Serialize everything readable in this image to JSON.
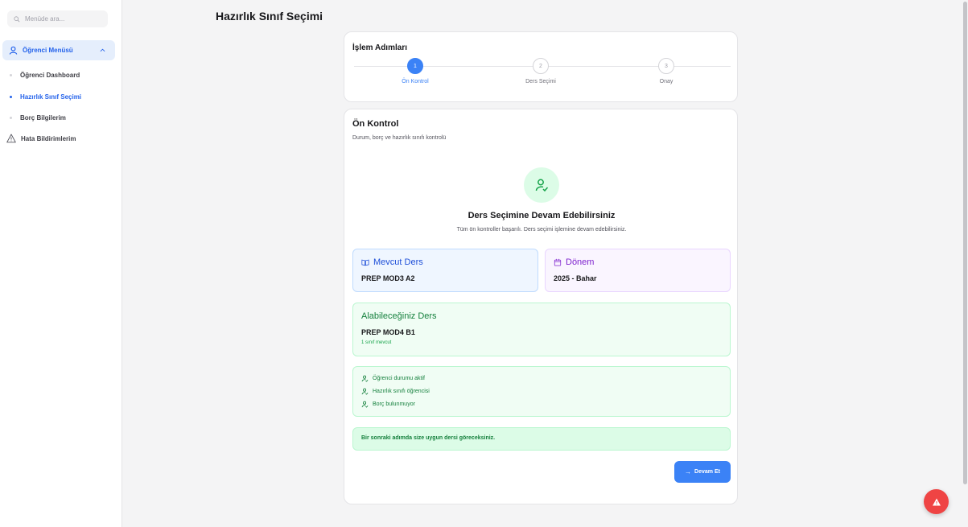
{
  "sidebar": {
    "search_placeholder": "Menüde ara...",
    "group_label": "Öğrenci Menüsü",
    "items": [
      {
        "label": "Öğrenci Dashboard",
        "active": false
      },
      {
        "label": "Hazırlık Sınıf Seçimi",
        "active": true
      },
      {
        "label": "Borç Bilgilerim",
        "active": false
      }
    ],
    "error_item": "Hata Bildirimlerim"
  },
  "page": {
    "title": "Hazırlık Sınıf Seçimi"
  },
  "steps": {
    "title": "İşlem Adımları",
    "items": [
      {
        "number": "1",
        "label": "Ön Kontrol",
        "active": true
      },
      {
        "number": "2",
        "label": "Ders Seçimi",
        "active": false
      },
      {
        "number": "3",
        "label": "Onay",
        "active": false
      }
    ]
  },
  "precheck": {
    "title": "Ön Kontrol",
    "subtitle": "Durum, borç ve hazırlık sınıfı kontrolü",
    "success_title": "Ders Seçimine Devam Edebilirsiniz",
    "success_sub": "Tüm ön kontroller başarılı. Ders seçimi işlemine devam edebilirsiniz.",
    "current_course": {
      "label": "Mevcut Ders",
      "value": "PREP MOD3 A2"
    },
    "term": {
      "label": "Dönem",
      "value": "2025 - Bahar"
    },
    "available": {
      "label": "Alabileceğiniz Ders",
      "value": "PREP MOD4 B1",
      "note": "1 sınıf mevcut"
    },
    "checks": [
      "Öğrenci durumu aktif",
      "Hazırlık sınıfı öğrencisi",
      "Borç bulunmuyor"
    ],
    "notice": "Bir sonraki adımda size uygun dersi göreceksiniz.",
    "continue_label": "Devam Et"
  },
  "colors": {
    "accent": "#3b82f6",
    "success": "#15803d",
    "danger": "#ef4444"
  },
  "icons": {
    "search": "search-icon",
    "group": "user-icon",
    "chevron": "chevron-up-icon",
    "error": "warning-triangle-icon",
    "current_course": "book-open-icon",
    "term": "calendar-icon",
    "check": "user-check-icon",
    "continue": "arrow-right-icon",
    "fab": "alert-triangle-icon"
  }
}
